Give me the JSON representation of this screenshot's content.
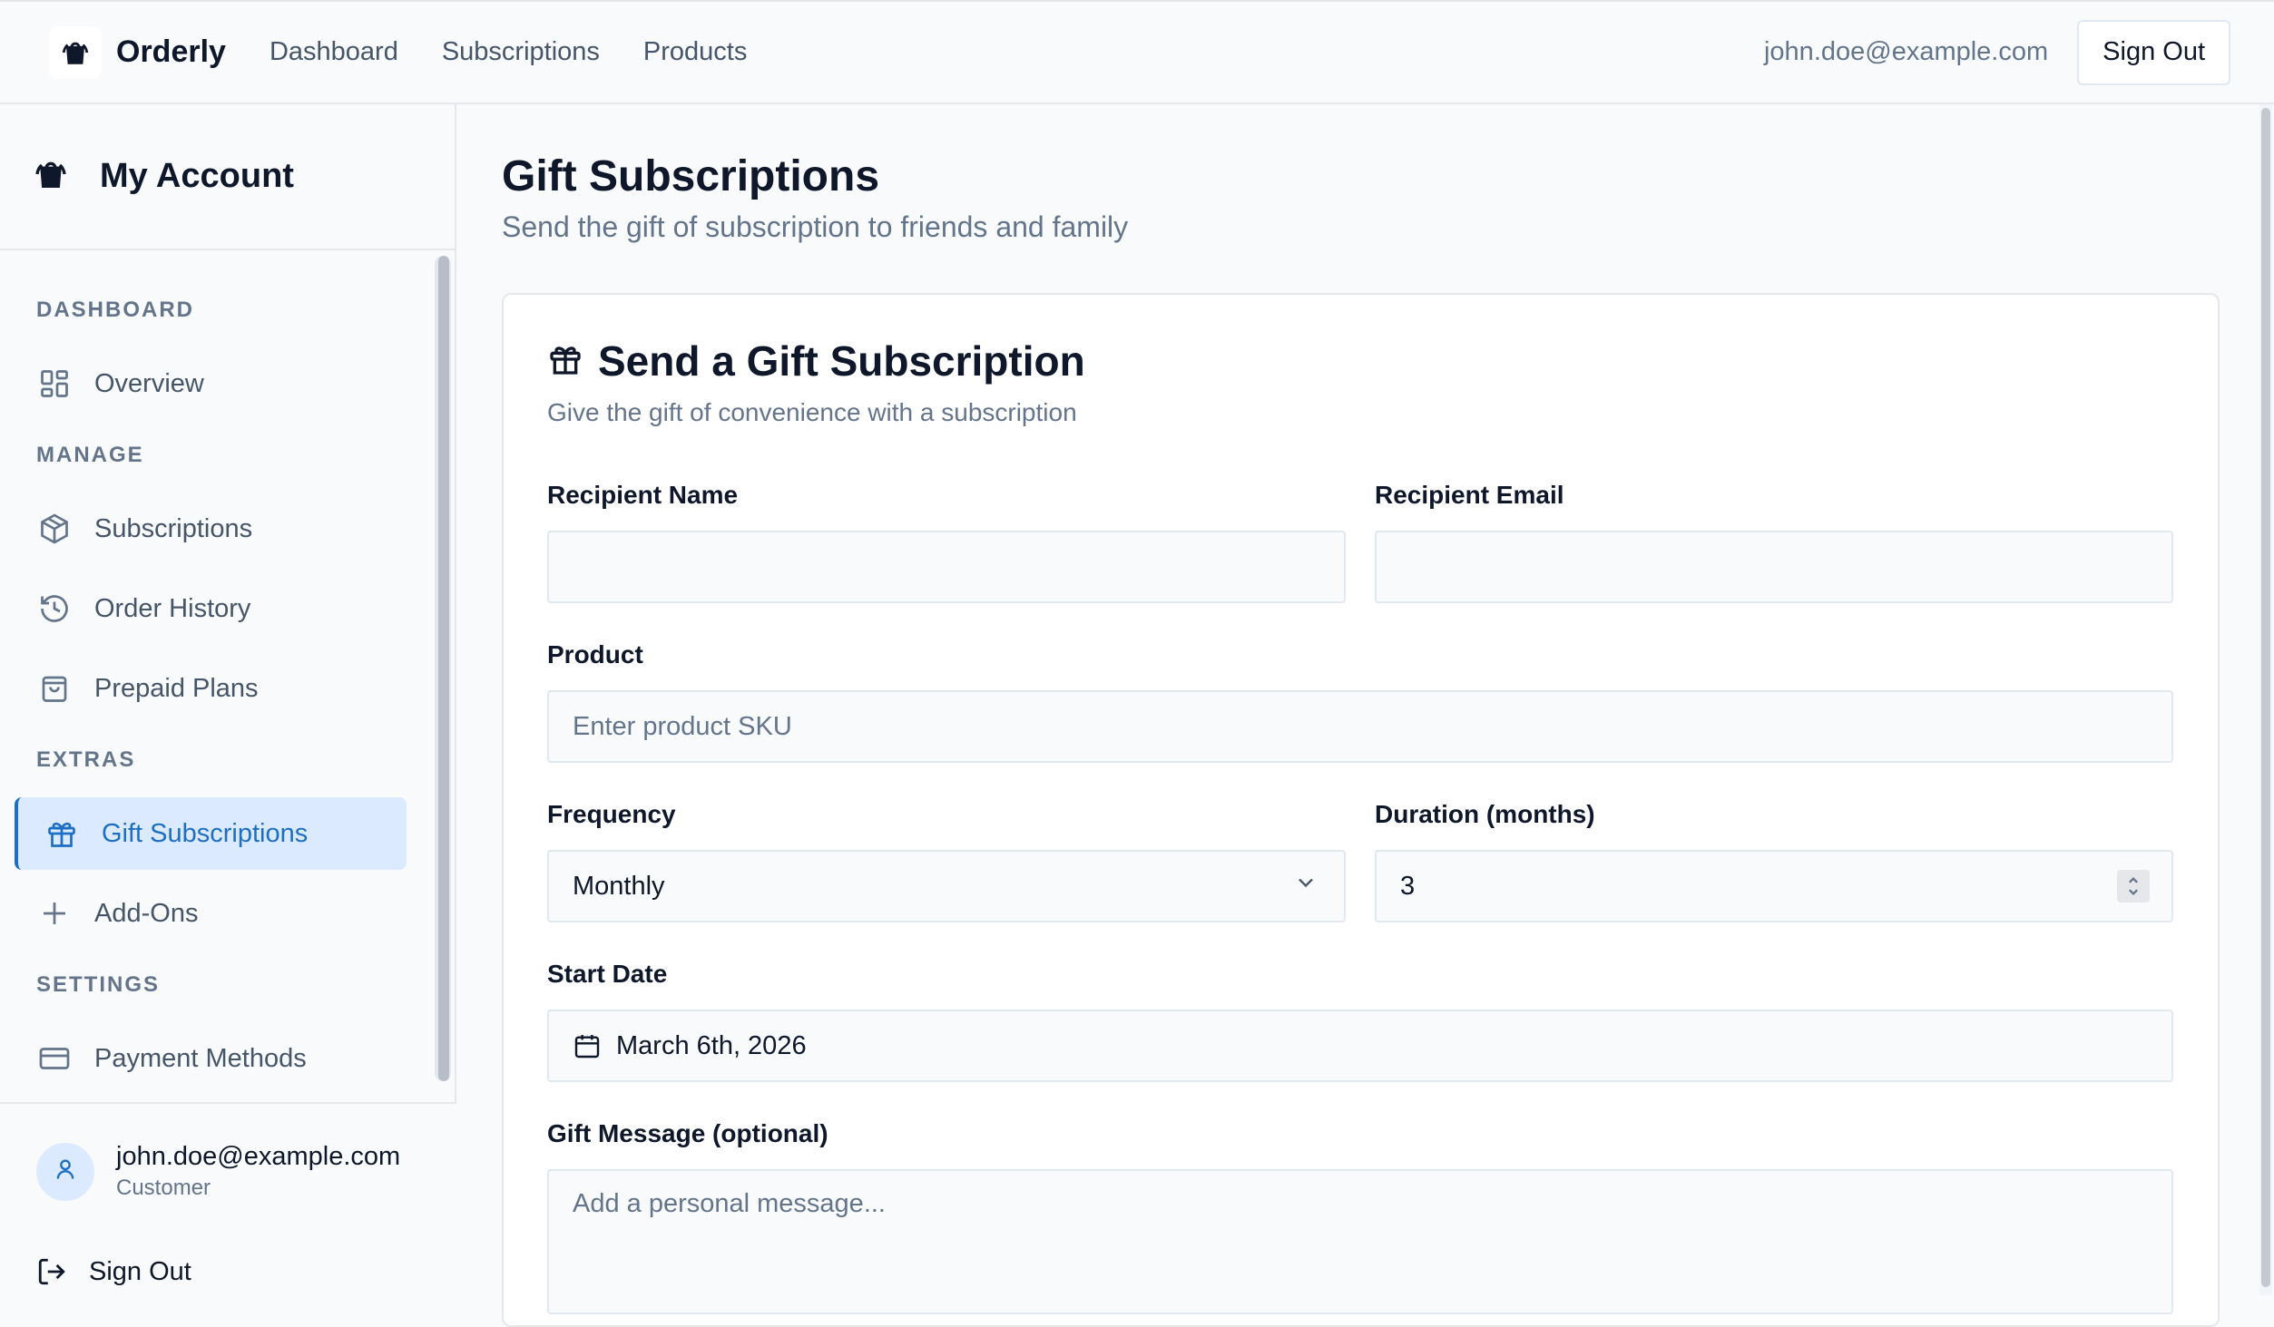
{
  "topbar": {
    "brand": "Orderly",
    "nav": [
      "Dashboard",
      "Subscriptions",
      "Products"
    ],
    "email": "john.doe@example.com",
    "signout": "Sign Out"
  },
  "sidebar": {
    "title": "My Account",
    "sections": {
      "dashboard": "DASHBOARD",
      "manage": "MANAGE",
      "extras": "EXTRAS",
      "settings": "SETTINGS"
    },
    "items": {
      "overview": "Overview",
      "subscriptions": "Subscriptions",
      "order_history": "Order History",
      "prepaid_plans": "Prepaid Plans",
      "gift_subscriptions": "Gift Subscriptions",
      "add_ons": "Add-Ons",
      "payment_methods": "Payment Methods"
    },
    "user": {
      "email": "john.doe@example.com",
      "role": "Customer"
    },
    "signout": "Sign Out",
    "active_color": "#1d6fc4"
  },
  "main": {
    "title": "Gift Subscriptions",
    "subtitle": "Send the gift of subscription to friends and family",
    "card": {
      "title": "Send a Gift Subscription",
      "subtitle": "Give the gift of convenience with a subscription",
      "recipient_name_label": "Recipient Name",
      "recipient_name_value": "",
      "recipient_email_label": "Recipient Email",
      "recipient_email_value": "",
      "product_label": "Product",
      "product_placeholder": "Enter product SKU",
      "frequency_label": "Frequency",
      "frequency_value": "Monthly",
      "duration_label": "Duration (months)",
      "duration_value": "3",
      "start_date_label": "Start Date",
      "start_date_value": "March 6th, 2026",
      "message_label": "Gift Message (optional)",
      "message_placeholder": "Add a personal message..."
    }
  }
}
